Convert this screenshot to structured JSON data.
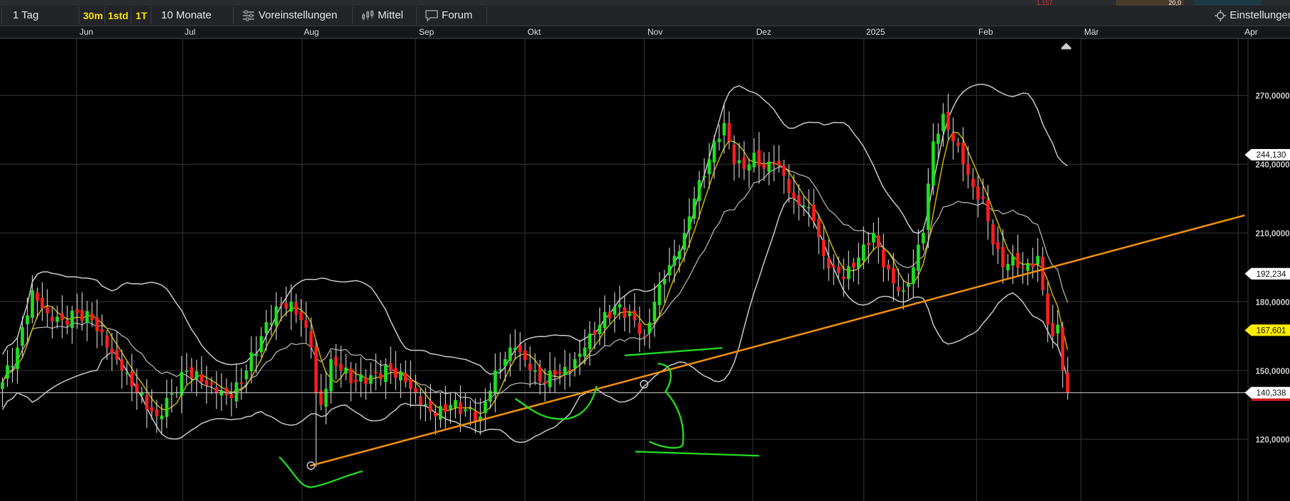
{
  "top_strip": {
    "value_red": "1.157",
    "value": "20,0"
  },
  "toolbar": {
    "period": "1 Tag",
    "intervals": [
      "30m",
      "1std",
      "1T"
    ],
    "range": "10 Monate",
    "presets": "Voreinstellungen",
    "indicator": "Mittel",
    "forum": "Forum",
    "settings": "Einstellungen"
  },
  "date_axis": {
    "months": [
      "Jun",
      "Jul",
      "Aug",
      "Sep",
      "Okt",
      "Nov",
      "Dez",
      "2025",
      "Feb",
      "Mär",
      "Apr"
    ]
  },
  "colors": {
    "up": "#1fe01f",
    "down": "#ff1e1e",
    "sma": "#c8b400",
    "bands": "#c8c8c8",
    "trendline": "#f0900a",
    "drawing": "#22dd22",
    "grid": "#2e2f33"
  },
  "chart_data": {
    "type": "candlestick",
    "timeframe": "1 Tag",
    "ylim": [
      95,
      290
    ],
    "y_ticks": [
      "270,0000",
      "240,0000",
      "210,0000",
      "180,0000",
      "150,0000",
      "120,0000"
    ],
    "y_tick_values": [
      270,
      240,
      210,
      180,
      150,
      120
    ],
    "price_tags": [
      {
        "label": "244,130",
        "value": 244.13,
        "style": "white"
      },
      {
        "label": "192,234",
        "value": 192.234,
        "style": "white"
      },
      {
        "label": "167,601",
        "value": 167.601,
        "style": "yellow"
      },
      {
        "label": "140,338",
        "value": 140.338,
        "style": "white-red"
      }
    ],
    "last_price": 140.338,
    "close_keypoints": [
      [
        0,
        145
      ],
      [
        3,
        160
      ],
      [
        6,
        185
      ],
      [
        9,
        175
      ],
      [
        12,
        172
      ],
      [
        15,
        175
      ],
      [
        18,
        172
      ],
      [
        21,
        160
      ],
      [
        24,
        150
      ],
      [
        27,
        140
      ],
      [
        31,
        130
      ],
      [
        34,
        140
      ],
      [
        37,
        150
      ],
      [
        40,
        145
      ],
      [
        43,
        140
      ],
      [
        46,
        138
      ],
      [
        49,
        150
      ],
      [
        52,
        165
      ],
      [
        55,
        178
      ],
      [
        58,
        180
      ],
      [
        60,
        172
      ],
      [
        62,
        160
      ],
      [
        63,
        140
      ],
      [
        64,
        135
      ],
      [
        66,
        155
      ],
      [
        68,
        150
      ],
      [
        71,
        145
      ],
      [
        74,
        148
      ],
      [
        78,
        150
      ],
      [
        81,
        145
      ],
      [
        84,
        135
      ],
      [
        87,
        130
      ],
      [
        90,
        135
      ],
      [
        93,
        133
      ],
      [
        96,
        130
      ],
      [
        99,
        150
      ],
      [
        101,
        155
      ],
      [
        103,
        160
      ],
      [
        106,
        150
      ],
      [
        108,
        145
      ],
      [
        111,
        148
      ],
      [
        114,
        150
      ],
      [
        117,
        160
      ],
      [
        120,
        170
      ],
      [
        123,
        178
      ],
      [
        126,
        175
      ],
      [
        129,
        165
      ],
      [
        131,
        180
      ],
      [
        133,
        190
      ],
      [
        135,
        200
      ],
      [
        137,
        210
      ],
      [
        139,
        225
      ],
      [
        141,
        235
      ],
      [
        143,
        250
      ],
      [
        145,
        258
      ],
      [
        147,
        240
      ],
      [
        149,
        238
      ],
      [
        151,
        245
      ],
      [
        153,
        238
      ],
      [
        155,
        240
      ],
      [
        157,
        235
      ],
      [
        159,
        225
      ],
      [
        161,
        222
      ],
      [
        163,
        215
      ],
      [
        165,
        200
      ],
      [
        167,
        195
      ],
      [
        169,
        190
      ],
      [
        171,
        195
      ],
      [
        173,
        205
      ],
      [
        175,
        210
      ],
      [
        177,
        195
      ],
      [
        179,
        188
      ],
      [
        181,
        185
      ],
      [
        183,
        195
      ],
      [
        185,
        210
      ],
      [
        187,
        250
      ],
      [
        189,
        262
      ],
      [
        191,
        250
      ],
      [
        193,
        240
      ],
      [
        195,
        230
      ],
      [
        197,
        225
      ],
      [
        198,
        215
      ],
      [
        199,
        205
      ],
      [
        201,
        195
      ],
      [
        203,
        200
      ],
      [
        205,
        195
      ],
      [
        207,
        195
      ],
      [
        208,
        200
      ],
      [
        209,
        185
      ],
      [
        210,
        170
      ],
      [
        211,
        165
      ],
      [
        212,
        170
      ],
      [
        213,
        150
      ],
      [
        214,
        140.338
      ]
    ],
    "special_lows": [
      {
        "day": 63,
        "low": 108
      }
    ],
    "indicators": [
      "Bollinger Bands (20, 2)",
      "SMA 20"
    ],
    "trendline": {
      "from": {
        "day": 62.5,
        "price": 108
      },
      "to": {
        "day": 250,
        "price": 218
      }
    }
  }
}
